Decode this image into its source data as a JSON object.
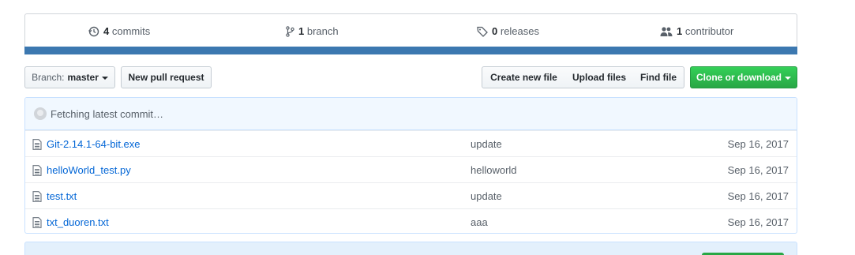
{
  "summary": {
    "commits": {
      "count": "4",
      "label": "commits",
      "icon": "history-icon"
    },
    "branches": {
      "count": "1",
      "label": "branch",
      "icon": "git-branch-icon"
    },
    "releases": {
      "count": "0",
      "label": "releases",
      "icon": "tag-icon"
    },
    "contributors": {
      "count": "1",
      "label": "contributor",
      "icon": "people-icon"
    }
  },
  "toolbar": {
    "branch_prefix": "Branch:",
    "branch_name": "master",
    "new_pull_request": "New pull request",
    "create_new_file": "Create new file",
    "upload_files": "Upload files",
    "find_file": "Find file",
    "clone_or_download": "Clone or download"
  },
  "commit_tease": {
    "text": "Fetching latest commit…"
  },
  "files": [
    {
      "name": "Git-2.14.1-64-bit.exe",
      "message": "update",
      "age": "Sep 16, 2017"
    },
    {
      "name": "helloWorld_test.py",
      "message": "helloworld",
      "age": "Sep 16, 2017"
    },
    {
      "name": "test.txt",
      "message": "update",
      "age": "Sep 16, 2017"
    },
    {
      "name": "txt_duoren.txt",
      "message": "aaa",
      "age": "Sep 16, 2017"
    }
  ],
  "colors": {
    "accent_bar": "#3c78b0",
    "link": "#0366d6",
    "clone_button": "#28a745"
  }
}
